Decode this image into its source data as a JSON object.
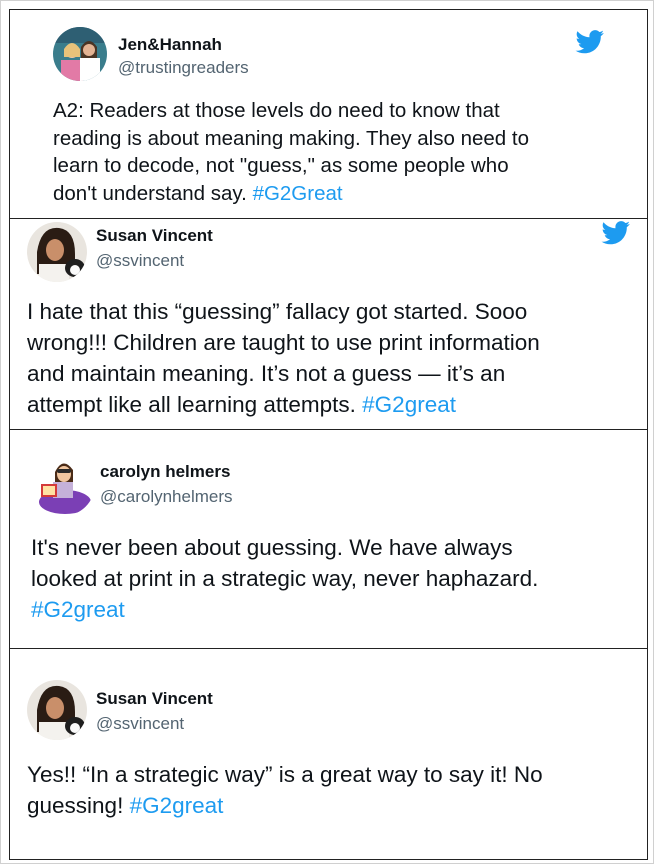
{
  "tweets": [
    {
      "author": "Jen&Hannah",
      "handle": "@trustingreaders",
      "avatar_icon": "two-women-avatar",
      "lines": [
        {
          "text": "A2: Readers at those levels do need to know that",
          "tag": ""
        },
        {
          "text": "reading is about meaning making. They also need to",
          "tag": ""
        },
        {
          "text": "learn to decode, not \"guess,\" as some people who",
          "tag": ""
        },
        {
          "text": "don't understand say. ",
          "tag": "#G2Great"
        }
      ]
    },
    {
      "author": "Susan Vincent",
      "handle": "@ssvincent",
      "avatar_icon": "woman-with-dog-avatar",
      "lines": [
        {
          "text": "I hate that this “guessing” fallacy got started. Sooo",
          "tag": ""
        },
        {
          "text": "wrong!!! Children are taught to use print information",
          "tag": ""
        },
        {
          "text": "and maintain meaning. It’s not a guess — it’s an",
          "tag": ""
        },
        {
          "text": "attempt like all learning attempts. ",
          "tag": "#G2great"
        }
      ]
    },
    {
      "author": "carolyn helmers",
      "handle": "@carolynhelmers",
      "avatar_icon": "bitmoji-reading-avatar",
      "lines": [
        {
          "text": "It's never been about guessing. We have always",
          "tag": ""
        },
        {
          "text": "looked at print in a strategic way, never haphazard.",
          "tag": ""
        },
        {
          "text": "",
          "tag": "#G2great"
        }
      ]
    },
    {
      "author": "Susan Vincent",
      "handle": "@ssvincent",
      "avatar_icon": "woman-with-dog-avatar",
      "lines": [
        {
          "text": "Yes!! “In a strategic way” is a great way to say it! No",
          "tag": ""
        },
        {
          "text": "guessing! ",
          "tag": "#G2great"
        }
      ]
    }
  ],
  "colors": {
    "hashtag": "#1d9bf0",
    "twitter_blue": "#1d9bf0",
    "handle_gray": "#536471",
    "border": "#222222"
  }
}
